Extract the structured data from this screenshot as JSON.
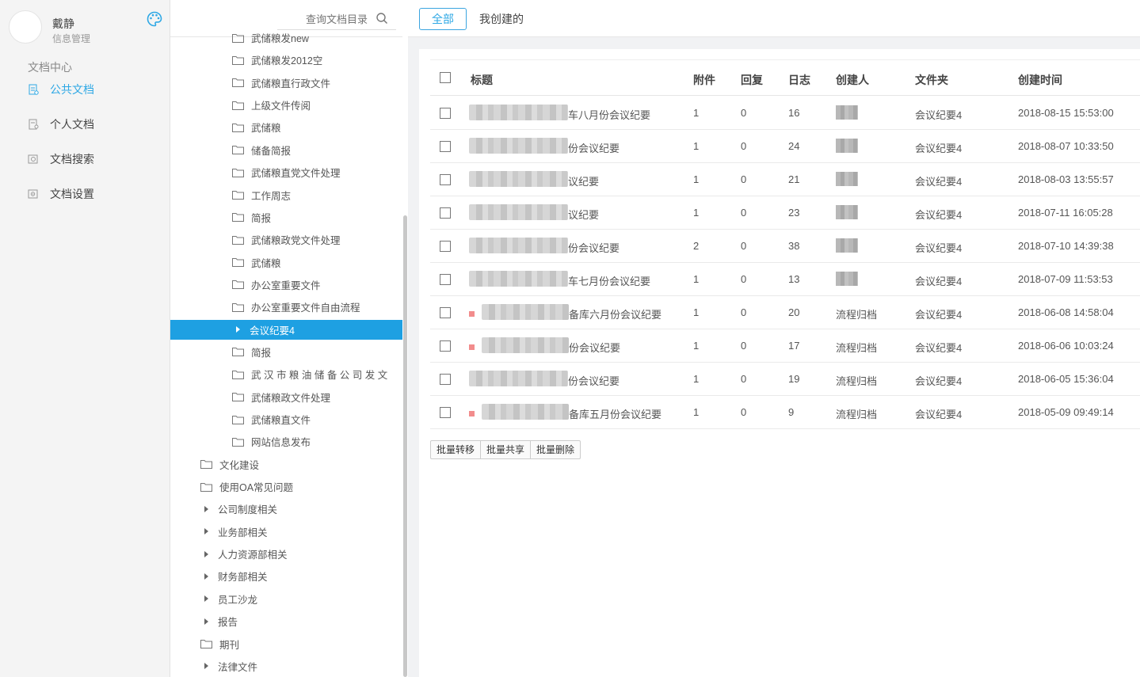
{
  "user": {
    "name": "戴静",
    "dept": "信息管理"
  },
  "nav": {
    "section": "文档中心",
    "items": [
      {
        "label": "公共文档",
        "icon": "public-doc-icon",
        "active": true
      },
      {
        "label": "个人文档",
        "icon": "personal-doc-icon",
        "active": false
      },
      {
        "label": "文档搜索",
        "icon": "doc-search-icon",
        "active": false
      },
      {
        "label": "文档设置",
        "icon": "doc-settings-icon",
        "active": false
      }
    ]
  },
  "tree": {
    "search_placeholder": "查询文档目录",
    "items": [
      {
        "label": "武储粮发new",
        "kind": "folder",
        "level": 2
      },
      {
        "label": "武储粮发2012空",
        "kind": "folder",
        "level": 2
      },
      {
        "label": "武储粮直行政文件",
        "kind": "folder",
        "level": 2
      },
      {
        "label": "上级文件传阅",
        "kind": "folder",
        "level": 2
      },
      {
        "label": "武储粮",
        "kind": "folder",
        "level": 2
      },
      {
        "label": "储备简报",
        "kind": "folder",
        "level": 2
      },
      {
        "label": "武储粮直党文件处理",
        "kind": "folder",
        "level": 2
      },
      {
        "label": "工作周志",
        "kind": "folder",
        "level": 2
      },
      {
        "label": "简报",
        "kind": "folder",
        "level": 2
      },
      {
        "label": "武储粮政党文件处理",
        "kind": "folder",
        "level": 2
      },
      {
        "label": "武储粮",
        "kind": "folder",
        "level": 2
      },
      {
        "label": "办公室重要文件",
        "kind": "folder",
        "level": 2
      },
      {
        "label": "办公室重要文件自由流程",
        "kind": "folder",
        "level": 2
      },
      {
        "label": "会议纪要4",
        "kind": "caret",
        "level": 2,
        "selected": true
      },
      {
        "label": "简报",
        "kind": "folder",
        "level": 2
      },
      {
        "label": "武 汉 市 粮 油 储 备 公 司 发 文",
        "kind": "folder",
        "level": 2
      },
      {
        "label": "武储粮政文件处理",
        "kind": "folder",
        "level": 2
      },
      {
        "label": "武储粮直文件",
        "kind": "folder",
        "level": 2
      },
      {
        "label": "网站信息发布",
        "kind": "folder",
        "level": 2
      },
      {
        "label": "文化建设",
        "kind": "folder",
        "level": 1
      },
      {
        "label": "使用OA常见问题",
        "kind": "folder",
        "level": 1
      },
      {
        "label": "公司制度相关",
        "kind": "caret",
        "level": 1
      },
      {
        "label": "业务部相关",
        "kind": "caret",
        "level": 1
      },
      {
        "label": "人力资源部相关",
        "kind": "caret",
        "level": 1
      },
      {
        "label": "财务部相关",
        "kind": "caret",
        "level": 1
      },
      {
        "label": "员工沙龙",
        "kind": "caret",
        "level": 1
      },
      {
        "label": "报告",
        "kind": "caret",
        "level": 1
      },
      {
        "label": "期刊",
        "kind": "folder",
        "level": 1
      },
      {
        "label": "法律文件",
        "kind": "caret",
        "level": 1
      }
    ]
  },
  "tabs": {
    "all": "全部",
    "mine": "我创建的"
  },
  "table": {
    "headers": {
      "title": "标题",
      "attach": "附件",
      "reply": "回复",
      "log": "日志",
      "creator": "创建人",
      "folder": "文件夹",
      "created": "创建时间"
    },
    "rows": [
      {
        "title": "车八月份会议纪要",
        "attach": "1",
        "reply": "0",
        "log": "16",
        "creator": "",
        "folder": "会议纪要4",
        "created": "2018-08-15 15:53:00",
        "mark": false
      },
      {
        "title": "份会议纪要",
        "attach": "1",
        "reply": "0",
        "log": "24",
        "creator": "",
        "folder": "会议纪要4",
        "created": "2018-08-07 10:33:50",
        "mark": false
      },
      {
        "title": "议纪要",
        "attach": "1",
        "reply": "0",
        "log": "21",
        "creator": "",
        "folder": "会议纪要4",
        "created": "2018-08-03 13:55:57",
        "mark": false
      },
      {
        "title": "议纪要",
        "attach": "1",
        "reply": "0",
        "log": "23",
        "creator": "",
        "folder": "会议纪要4",
        "created": "2018-07-11 16:05:28",
        "mark": false
      },
      {
        "title": "份会议纪要",
        "attach": "2",
        "reply": "0",
        "log": "38",
        "creator": "",
        "folder": "会议纪要4",
        "created": "2018-07-10 14:39:38",
        "mark": false
      },
      {
        "title": "车七月份会议纪要",
        "attach": "1",
        "reply": "0",
        "log": "13",
        "creator": "",
        "folder": "会议纪要4",
        "created": "2018-07-09 11:53:53",
        "mark": false
      },
      {
        "title": "备库六月份会议纪要",
        "attach": "1",
        "reply": "0",
        "log": "20",
        "creator": "流程归档",
        "folder": "会议纪要4",
        "created": "2018-06-08 14:58:04",
        "mark": true
      },
      {
        "title": "份会议纪要",
        "attach": "1",
        "reply": "0",
        "log": "17",
        "creator": "流程归档",
        "folder": "会议纪要4",
        "created": "2018-06-06 10:03:24",
        "mark": true
      },
      {
        "title": "份会议纪要",
        "attach": "1",
        "reply": "0",
        "log": "19",
        "creator": "流程归档",
        "folder": "会议纪要4",
        "created": "2018-06-05 15:36:04",
        "mark": false
      },
      {
        "title": "备库五月份会议纪要",
        "attach": "1",
        "reply": "0",
        "log": "9",
        "creator": "流程归档",
        "folder": "会议纪要4",
        "created": "2018-05-09 09:49:14",
        "mark": true
      }
    ]
  },
  "batch": {
    "move": "批量转移",
    "share": "批量共享",
    "delete": "批量删除"
  },
  "colors": {
    "accent": "#2ea8e5",
    "selected_bg": "#1ea0e2",
    "mark": "#f28c8c"
  }
}
